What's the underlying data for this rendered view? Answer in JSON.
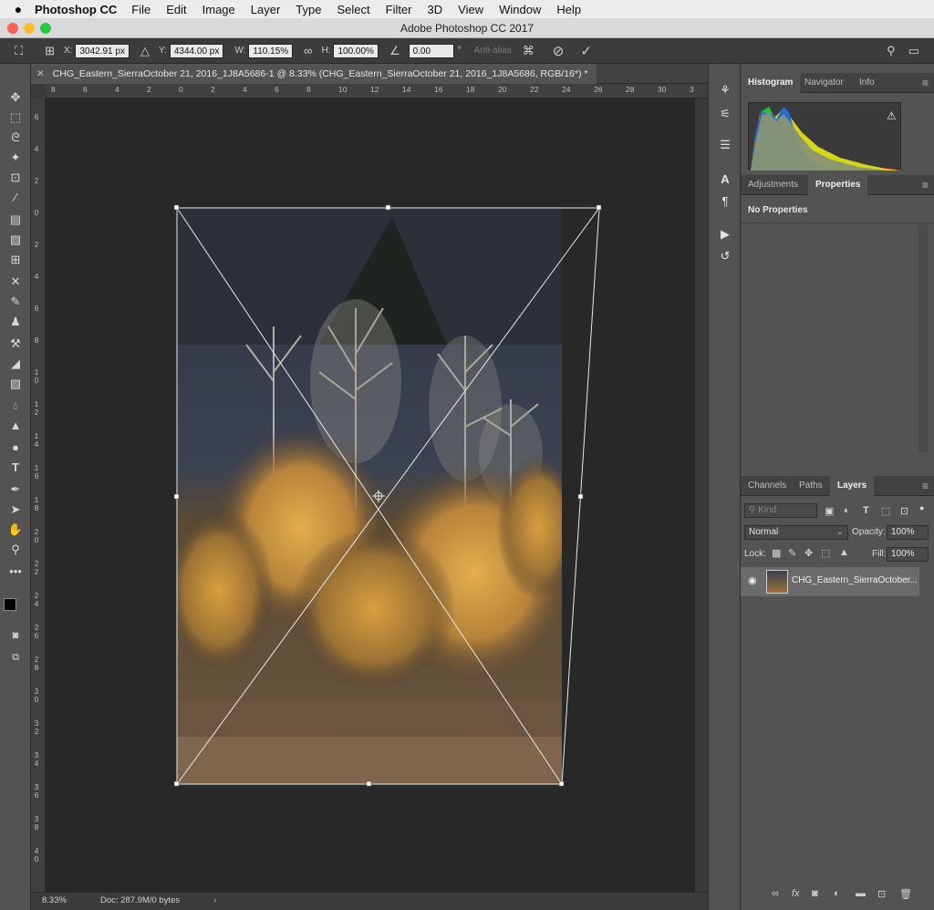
{
  "menubar": {
    "apple_icon": "apple-icon",
    "app_name": "Photoshop CC",
    "items": [
      "File",
      "Edit",
      "Image",
      "Layer",
      "Type",
      "Select",
      "Filter",
      "3D",
      "View",
      "Window",
      "Help"
    ]
  },
  "window": {
    "title": "Adobe Photoshop CC 2017"
  },
  "options_bar": {
    "x_label": "X:",
    "x_value": "3042.91 px",
    "y_label": "Y:",
    "y_value": "4344.00 px",
    "w_label": "W:",
    "w_value": "110.15%",
    "h_label": "H:",
    "h_value": "100.00%",
    "angle_value": "0.00",
    "angle_unit": "°",
    "antialias_label": "Anti-alias"
  },
  "document_tab": {
    "label": "CHG_Eastern_SierraOctober 21, 2016_1J8A5686-1 @ 8.33% (CHG_Eastern_SierraOctober 21, 2016_1J8A5686, RGB/16*) *"
  },
  "rulers": {
    "h_labels": [
      "8",
      "6",
      "4",
      "2",
      "0",
      "2",
      "4",
      "6",
      "8",
      "10",
      "12",
      "14",
      "16",
      "18",
      "20",
      "22",
      "24",
      "26",
      "28",
      "30",
      "3"
    ],
    "v_labels": [
      "6",
      "4",
      "2",
      "0",
      "2",
      "4",
      "6",
      "8",
      "1\n0",
      "1\n2",
      "1\n4",
      "1\n6",
      "1\n8",
      "2\n0",
      "2\n2",
      "2\n4",
      "2\n6",
      "2\n8",
      "3\n0",
      "3\n2",
      "3\n4",
      "3\n6",
      "3\n8",
      "4\n0"
    ]
  },
  "status_bar": {
    "zoom": "8.33%",
    "doc_info": "Doc: 287.9M/0 bytes"
  },
  "panels": {
    "top_tabs": [
      "Histogram",
      "Navigator",
      "Info"
    ],
    "props_tabs": [
      "Adjustments",
      "Properties"
    ],
    "properties_text": "No Properties",
    "layers_tabs": [
      "Channels",
      "Paths",
      "Layers"
    ],
    "kind_placeholder": "Kind",
    "blend_mode": "Normal",
    "opacity_label": "Opacity:",
    "opacity_value": "100%",
    "lock_label": "Lock:",
    "fill_label": "Fill:",
    "fill_value": "100%",
    "layer_name": "CHG_Eastern_SierraOctober..."
  }
}
